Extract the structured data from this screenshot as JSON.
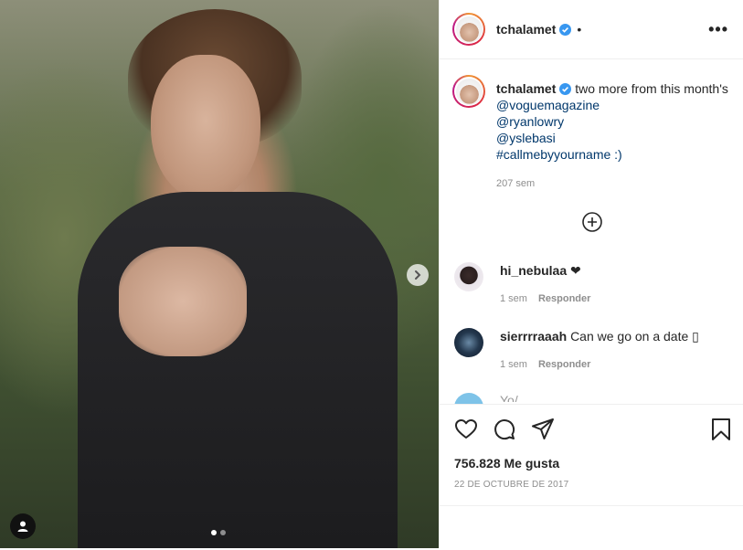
{
  "post": {
    "image_alt": "",
    "carousel": {
      "count": 2,
      "active": 0
    }
  },
  "header": {
    "username": "tchalamet",
    "separator": "•"
  },
  "caption": {
    "username": "tchalamet",
    "text": "two more from this month's",
    "mentions": [
      "@voguemagazine",
      "@ryanlowry",
      "@yslebasi"
    ],
    "hashtag_line": "#callmebyyourname :)",
    "time": "207 sem"
  },
  "comments": [
    {
      "username": "hi_nebulaa",
      "text": "❤",
      "time": "1 sem",
      "reply": "Responder"
    },
    {
      "username": "sierrrraaah",
      "text": "Can we go on a date ▯",
      "time": "1 sem",
      "reply": "Responder"
    }
  ],
  "partial_comment": {
    "text": "Yo/ ..."
  },
  "engagement": {
    "likes": "756.828 Me gusta",
    "date": "22 DE OCTUBRE DE 2017"
  },
  "icons": {
    "like": "heart-icon",
    "comment": "comment-icon",
    "share": "send-icon",
    "save": "bookmark-icon",
    "more": "more-options-icon",
    "add": "plus-circle-icon",
    "next": "chevron-right-icon",
    "tag": "user-tag-icon",
    "verified": "verified-badge-icon"
  },
  "colors": {
    "link": "#00376b",
    "verified": "#3897f0",
    "muted": "#8e8e8e"
  }
}
